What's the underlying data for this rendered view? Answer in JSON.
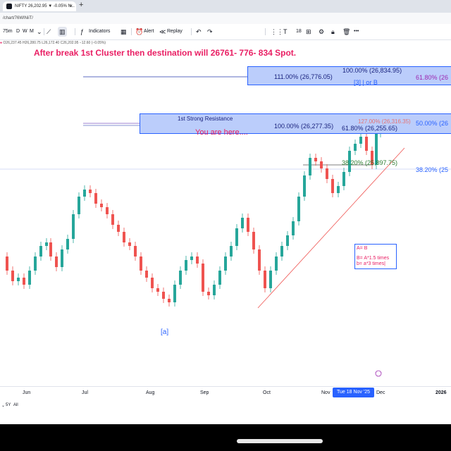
{
  "browser": {
    "tab_title": "NIFTY 26,202.95 ▼ -0.05% N...",
    "tab_close": "×",
    "new_tab": "+",
    "url": "/chart/76WINiiT/"
  },
  "toolbar": {
    "interval": "75m",
    "range_d": "D",
    "range_w": "W",
    "range_m": "M",
    "indicators_label": "Indicators",
    "alert_label": "Alert",
    "replay_label": "Replay",
    "font_size": "18",
    "more": "•••"
  },
  "legend": {
    "ohlc": "O26,237.45 H26,280.75 L26,172.40 C26,202.95 −12.60 (−0.05%)"
  },
  "annotations": {
    "headline": "After break 1st Cluster then destination will  26761- 776- 834 Spot.",
    "you_are_here": "You are here....",
    "first_resistance": "1st Strong Resistance",
    "fib_100_top": "100.00% (26,834.95)",
    "fib_111": "111.00% (26,776.05)",
    "fib_618_right_top": "61.80% (26",
    "wave_label_3": "[3] |   or B",
    "fib_127": "127.00% (26,316.35)",
    "fib_100_mid": "100.00% (26,277.35)",
    "fib_618_mid": "61.80% (26,255.65)",
    "fib_50_right": "50.00% (26",
    "fib_382_mid": "38.20% (25,897.75)",
    "fib_382_right": "38.20% (25",
    "wave_label_a": "[a]",
    "note_line1": "A= B",
    "note_line2": "B= A*1.5 times",
    "note_line3": "b= a*3 times|"
  },
  "xaxis": {
    "months": [
      "Jun",
      "Jul",
      "Aug",
      "Sep",
      "Oct",
      "Nov",
      "Dec",
      "2026"
    ],
    "crosshair_date": "Tue 18 Nov '25"
  },
  "bottom": {
    "range_5y": "5Y",
    "range_all": "All"
  },
  "colors": {
    "up": "#26a69a",
    "down": "#ef5350",
    "annotation_text": "#e91e63",
    "fib_blue": "#2962ff",
    "box_fill": "#bbcdfb"
  }
}
